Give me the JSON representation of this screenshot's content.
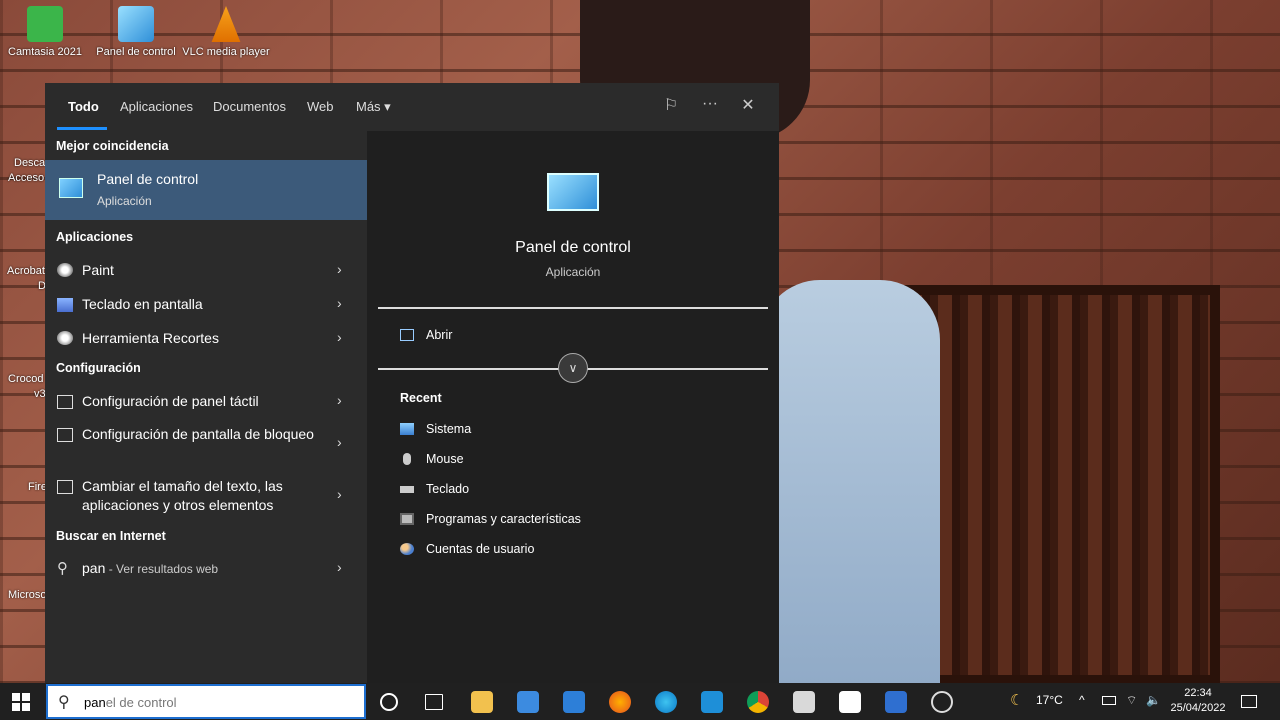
{
  "desktop": {
    "icons": [
      {
        "label": "Camtasia 2021",
        "color": "#3bb54a"
      },
      {
        "label": "Panel de control",
        "color": "#4aa9e8"
      },
      {
        "label": "VLC media player",
        "color": "#f08a00"
      }
    ],
    "side_labels": [
      "Desca",
      "Acceso",
      "Acrobat",
      "D",
      "Crocod",
      "v3",
      "Fire",
      "Microso"
    ]
  },
  "search": {
    "tabs": [
      "Todo",
      "Aplicaciones",
      "Documentos",
      "Web",
      "Más ▾"
    ],
    "best_match_title": "Mejor coincidencia",
    "best_match": {
      "name": "Panel de control",
      "type": "Aplicación"
    },
    "apps_title": "Aplicaciones",
    "apps": [
      "Paint",
      "Teclado en pantalla",
      "Herramienta Recortes"
    ],
    "config_title": "Configuración",
    "config": [
      "Configuración de panel táctil",
      "Configuración de pantalla de bloqueo",
      "Cambiar el tamaño del texto, las aplicaciones y otros elementos"
    ],
    "web_title": "Buscar en Internet",
    "web_query": "pan",
    "web_suffix": " - Ver resultados web",
    "chevron": "›",
    "detail": {
      "name": "Panel de control",
      "type": "Aplicación",
      "open_label": "Abrir",
      "recent_title": "Recent",
      "recent": [
        "Sistema",
        "Mouse",
        "Teclado",
        "Programas y características",
        "Cuentas de usuario"
      ]
    }
  },
  "taskbar": {
    "search_typed": "pan",
    "search_rest": "el de control",
    "temperature": "17°C",
    "time": "22:34",
    "date": "25/04/2022"
  }
}
